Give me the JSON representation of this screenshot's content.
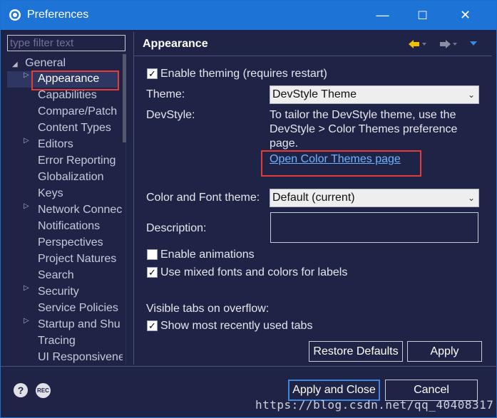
{
  "window": {
    "title": "Preferences",
    "minimize_glyph": "—",
    "maximize_glyph": "☐",
    "close_glyph": "✕",
    "accent": "#1e73d6"
  },
  "filter": {
    "placeholder": "type filter text"
  },
  "tree": {
    "root": "General",
    "items": [
      {
        "label": "Appearance",
        "expandable": true,
        "selected": true
      },
      {
        "label": "Capabilities",
        "expandable": false
      },
      {
        "label": "Compare/Patch",
        "expandable": false
      },
      {
        "label": "Content Types",
        "expandable": false
      },
      {
        "label": "Editors",
        "expandable": true
      },
      {
        "label": "Error Reporting",
        "expandable": false
      },
      {
        "label": "Globalization",
        "expandable": false
      },
      {
        "label": "Keys",
        "expandable": false
      },
      {
        "label": "Network Connec",
        "expandable": true
      },
      {
        "label": "Notifications",
        "expandable": false
      },
      {
        "label": "Perspectives",
        "expandable": false
      },
      {
        "label": "Project Natures",
        "expandable": false
      },
      {
        "label": "Search",
        "expandable": false
      },
      {
        "label": "Security",
        "expandable": true
      },
      {
        "label": "Service Policies",
        "expandable": false
      },
      {
        "label": "Startup and Shu",
        "expandable": true
      },
      {
        "label": "Tracing",
        "expandable": false
      },
      {
        "label": "UI Responsivene",
        "expandable": false
      }
    ]
  },
  "page": {
    "title": "Appearance",
    "enable_theming": {
      "label": "Enable theming (requires restart)",
      "checked": true
    },
    "theme_label": "Theme:",
    "theme_value": "DevStyle Theme",
    "devstyle_label": "DevStyle:",
    "devstyle_text_1": "To tailor the DevStyle theme, use the",
    "devstyle_text_2": "DevStyle > Color Themes preference",
    "devstyle_text_3": "page.",
    "open_link": "Open Color Themes page",
    "color_font_label": "Color and Font theme:",
    "color_font_value": "Default (current)",
    "description_label": "Description:",
    "enable_animations": {
      "label": "Enable animations",
      "checked": false
    },
    "mixed_fonts": {
      "label": "Use mixed fonts and colors for labels",
      "checked": true
    },
    "visible_tabs_label": "Visible tabs on overflow:",
    "show_recent": {
      "label": "Show most recently used tabs",
      "checked": true
    },
    "restore_defaults": "Restore Defaults",
    "apply": "Apply"
  },
  "footer": {
    "help_glyph": "?",
    "rec_label": "REC",
    "apply_close": "Apply and Close",
    "cancel": "Cancel",
    "watermark": "https://blog.csdn.net/qq_40408317"
  }
}
